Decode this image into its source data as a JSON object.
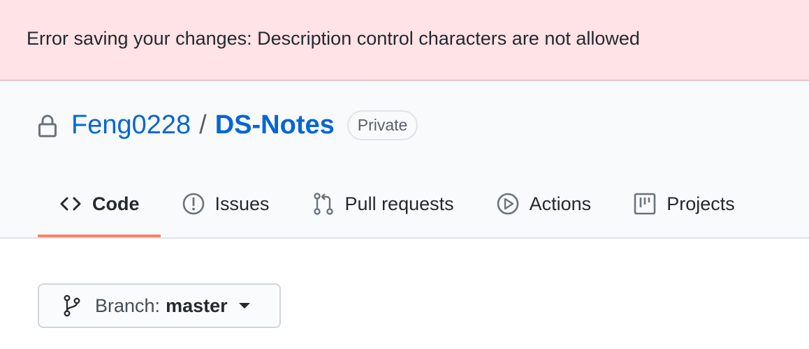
{
  "flash": {
    "message": "Error saving your changes: Description control characters are not allowed"
  },
  "repo": {
    "owner": "Feng0228",
    "separator": "/",
    "name": "DS-Notes",
    "visibility": "Private"
  },
  "tabs": [
    {
      "label": "Code",
      "icon": "code-icon",
      "selected": true
    },
    {
      "label": "Issues",
      "icon": "issue-icon",
      "selected": false
    },
    {
      "label": "Pull requests",
      "icon": "pull-request-icon",
      "selected": false
    },
    {
      "label": "Actions",
      "icon": "play-icon",
      "selected": false
    },
    {
      "label": "Projects",
      "icon": "project-icon",
      "selected": false
    }
  ],
  "branch": {
    "label": "Branch:",
    "name": "master"
  },
  "colors": {
    "flash_bg": "#ffe3e6",
    "link": "#0366d6",
    "tab_underline": "#f9826c"
  }
}
